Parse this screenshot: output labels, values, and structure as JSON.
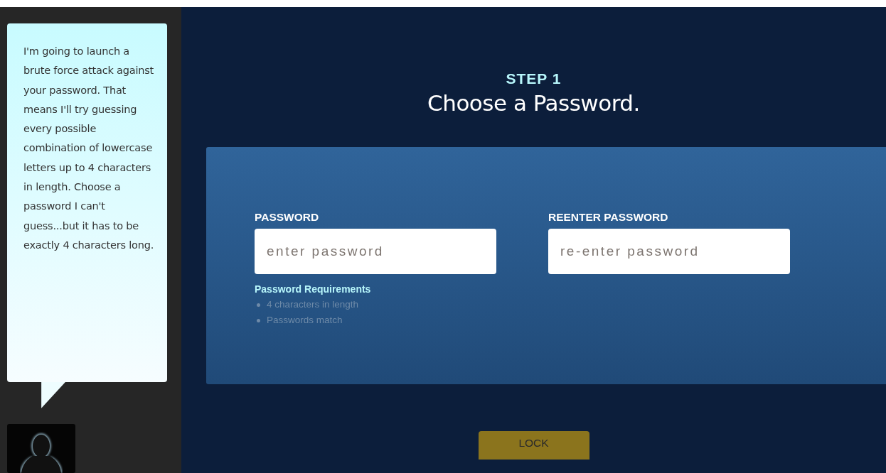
{
  "sidebar": {
    "message": "I'm going to launch a brute force attack against your password. That means I'll try guessing every possible combination of lowercase letters up to 4 characters in length. Choose a password I can't guess...but it has to be exactly 4 characters long."
  },
  "step": {
    "label": "STEP 1",
    "title": "Choose a Password."
  },
  "form": {
    "fields": [
      {
        "label": "PASSWORD",
        "placeholder": "enter password"
      },
      {
        "label": "REENTER PASSWORD",
        "placeholder": "re-enter password"
      }
    ],
    "requirements": {
      "title": "Password Requirements",
      "items": [
        {
          "text": "4 characters in length",
          "met": false
        },
        {
          "text": "Passwords match",
          "met": false
        }
      ]
    }
  },
  "button": {
    "label": "LOCK"
  }
}
